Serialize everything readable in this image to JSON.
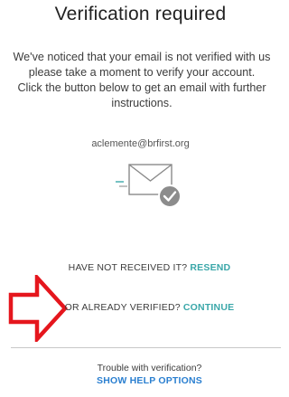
{
  "title": "Verification required",
  "message": {
    "lines": [
      "We've noticed that your email is not verified with us",
      "please take a moment to verify your account.",
      "Click the button below to get an email with further",
      "instructions."
    ]
  },
  "email": "aclemente@brfirst.org",
  "icons": {
    "envelope": "envelope-check-icon",
    "arrow": "red-arrow-right-icon"
  },
  "resend": {
    "prompt": "HAVE NOT RECEIVED IT? ",
    "link": "RESEND"
  },
  "continue": {
    "prompt": "OR ALREADY VERIFIED? ",
    "link": "CONTINUE"
  },
  "help": {
    "text": "Trouble with verification?",
    "link": "SHOW HELP OPTIONS"
  },
  "colors": {
    "accent": "#3aa7a9",
    "help_link": "#2a7fd0",
    "arrow": "#e5161d",
    "check_badge": "#8c8c8c"
  }
}
